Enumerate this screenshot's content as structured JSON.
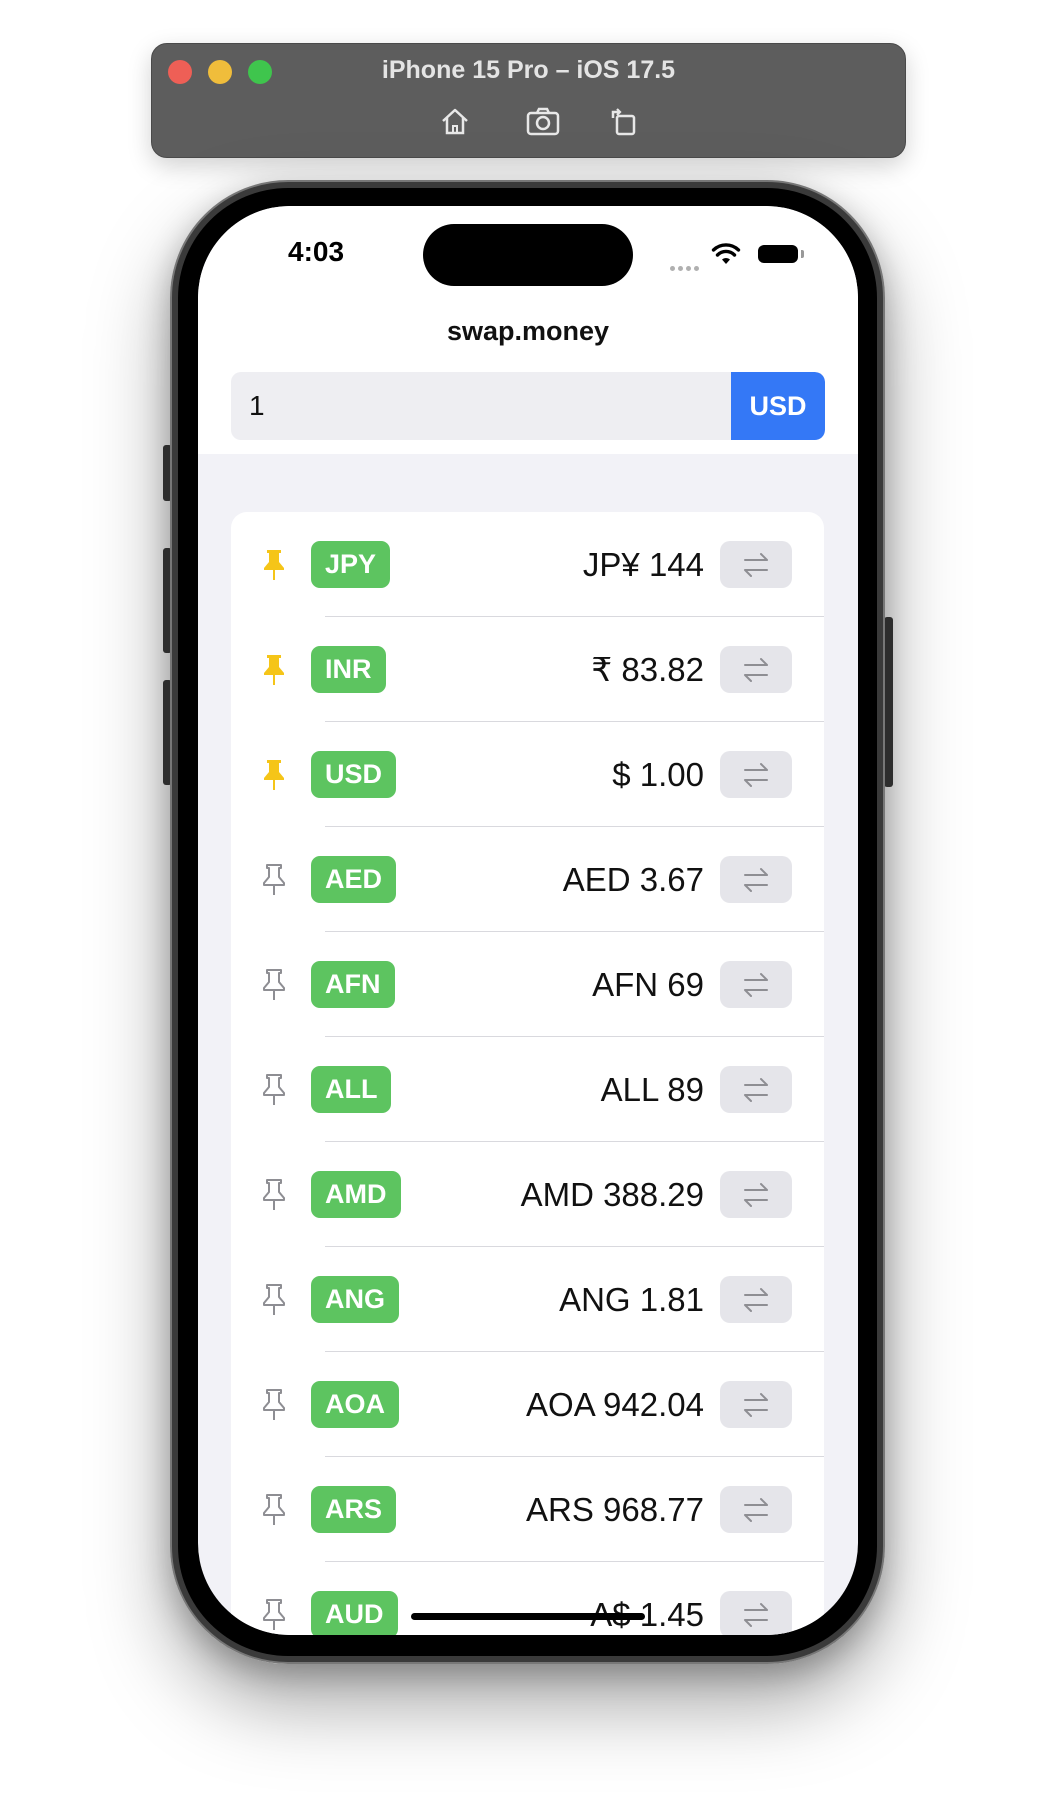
{
  "simulator": {
    "title": "iPhone 15 Pro – iOS 17.5",
    "tools": [
      "home-icon",
      "screenshot-icon",
      "rotate-icon"
    ]
  },
  "status_bar": {
    "time": "4:03"
  },
  "app": {
    "title": "swap.money",
    "amount_value": "1",
    "base_currency": "USD"
  },
  "colors": {
    "accent": "#3478f6",
    "badge": "#5dc460",
    "pinned": "#f5c518",
    "unpinned": "#8e8e93"
  },
  "currencies": [
    {
      "code": "JPY",
      "amount": "JP¥ 144",
      "pinned": true
    },
    {
      "code": "INR",
      "amount": "₹ 83.82",
      "pinned": true
    },
    {
      "code": "USD",
      "amount": "$ 1.00",
      "pinned": true
    },
    {
      "code": "AED",
      "amount": "AED 3.67",
      "pinned": false
    },
    {
      "code": "AFN",
      "amount": "AFN 69",
      "pinned": false
    },
    {
      "code": "ALL",
      "amount": "ALL 89",
      "pinned": false
    },
    {
      "code": "AMD",
      "amount": "AMD 388.29",
      "pinned": false
    },
    {
      "code": "ANG",
      "amount": "ANG 1.81",
      "pinned": false
    },
    {
      "code": "AOA",
      "amount": "AOA 942.04",
      "pinned": false
    },
    {
      "code": "ARS",
      "amount": "ARS 968.77",
      "pinned": false
    },
    {
      "code": "AUD",
      "amount": "A$ 1.45",
      "pinned": false
    }
  ]
}
